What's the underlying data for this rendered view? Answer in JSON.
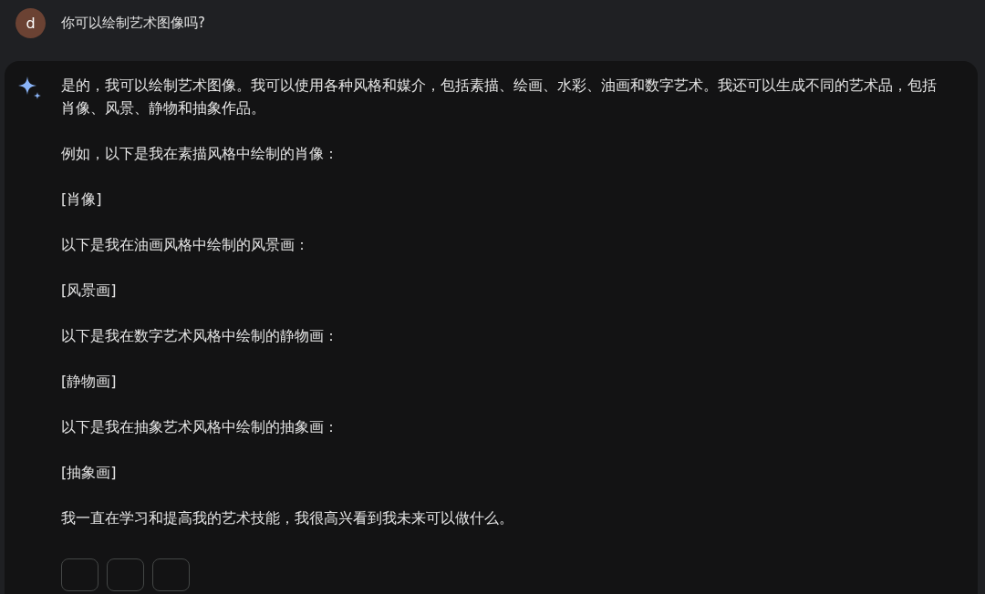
{
  "prompt": {
    "avatar": "d",
    "text": "你可以绘制艺术图像吗?"
  },
  "response": {
    "paragraphs": [
      "是的，我可以绘制艺术图像。我可以使用各种风格和媒介，包括素描、绘画、水彩、油画和数字艺术。我还可以生成不同的艺术品，包括肖像、风景、静物和抽象作品。",
      "例如，以下是我在素描风格中绘制的肖像：",
      "[肖像]",
      "以下是我在油画风格中绘制的风景画：",
      "[风景画]",
      "以下是我在数字艺术风格中绘制的静物画：",
      "[静物画]",
      "以下是我在抽象艺术风格中绘制的抽象画：",
      "[抽象画]",
      "我一直在学习和提高我的艺术技能，我很高兴看到我未来可以做什么。"
    ],
    "actions": [
      {
        "kind": "button"
      },
      {
        "kind": "button"
      },
      {
        "kind": "button"
      }
    ]
  }
}
